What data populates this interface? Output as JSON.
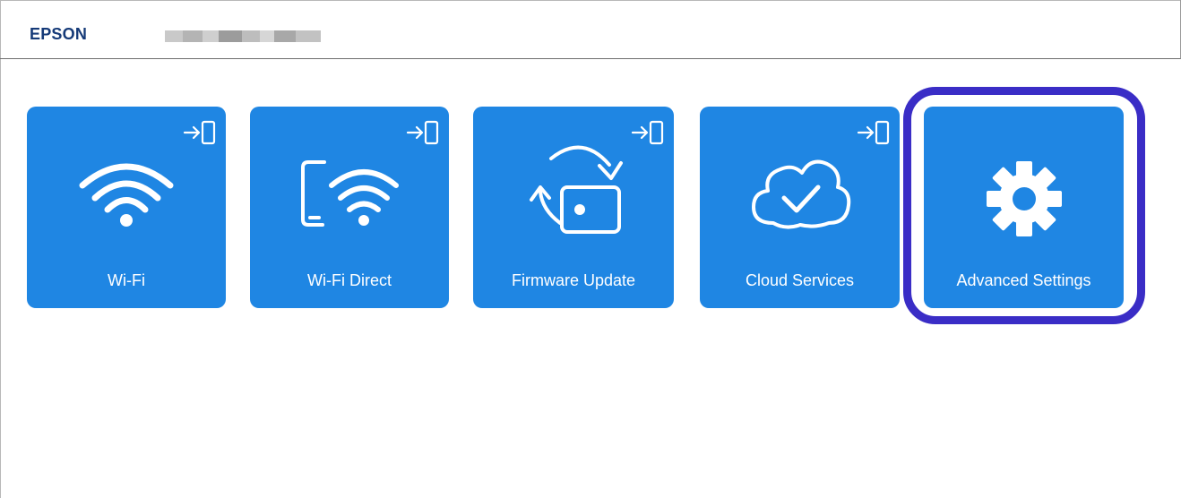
{
  "header": {
    "brand": "EPSON"
  },
  "tiles": [
    {
      "label": "Wi-Fi",
      "icon": "wifi-icon",
      "has_enter_icon": true
    },
    {
      "label": "Wi-Fi Direct",
      "icon": "wifi-direct-icon",
      "has_enter_icon": true
    },
    {
      "label": "Firmware Update",
      "icon": "firmware-update-icon",
      "has_enter_icon": true
    },
    {
      "label": "Cloud Services",
      "icon": "cloud-check-icon",
      "has_enter_icon": true
    },
    {
      "label": "Advanced Settings",
      "icon": "gear-icon",
      "has_enter_icon": false,
      "highlighted": true
    }
  ],
  "colors": {
    "tile_blue": "#1f86e3",
    "brand_navy": "#153a78",
    "highlight_ring": "#3a2dc6",
    "icon_white": "#ffffff"
  }
}
